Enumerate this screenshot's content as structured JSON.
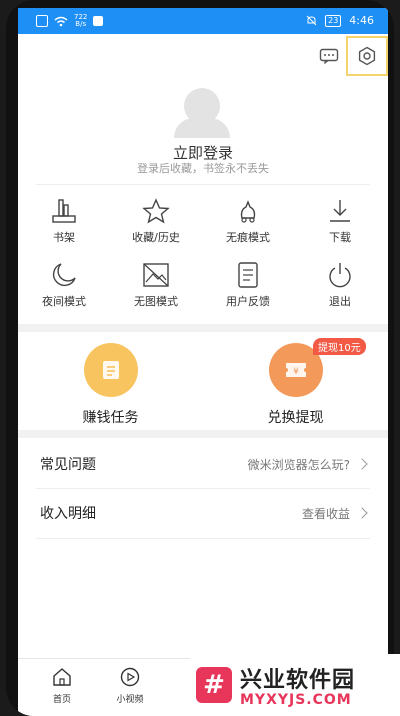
{
  "status_bar": {
    "speed_value": "722",
    "speed_unit": "B/s",
    "battery": "23",
    "time": "4:46"
  },
  "header": {
    "message_icon": "message-icon",
    "settings_icon": "gear-icon"
  },
  "profile": {
    "login_title": "立即登录",
    "login_subtitle": "登录后收藏，书签永不丢失"
  },
  "grid_items": [
    {
      "label": "书架",
      "icon": "bookshelf-icon"
    },
    {
      "label": "收藏/历史",
      "icon": "star-icon"
    },
    {
      "label": "无痕模式",
      "icon": "incognito-icon"
    },
    {
      "label": "下载",
      "icon": "download-icon"
    },
    {
      "label": "夜间模式",
      "icon": "moon-icon"
    },
    {
      "label": "无图模式",
      "icon": "no-image-icon"
    },
    {
      "label": "用户反馈",
      "icon": "feedback-icon"
    },
    {
      "label": "退出",
      "icon": "power-icon"
    }
  ],
  "tasks": [
    {
      "label": "赚钱任务",
      "color": "#f7c45f"
    },
    {
      "label": "兑换提现",
      "color": "#f39a5a",
      "badge": "提现10元"
    }
  ],
  "rows": [
    {
      "label": "常见问题",
      "value": "微米浏览器怎么玩?"
    },
    {
      "label": "收入明细",
      "value": "查看收益"
    }
  ],
  "tabs": [
    {
      "label": "首页",
      "icon": "home-icon"
    },
    {
      "label": "小视频",
      "icon": "video-icon"
    }
  ],
  "watermark": {
    "logo_glyph": "#",
    "cn": "兴业软件园",
    "en": "MYXYJS.COM"
  },
  "colors": {
    "status_bar": "#1e8ff4",
    "badge": "#f25a46",
    "highlight": "#f3d36b"
  }
}
